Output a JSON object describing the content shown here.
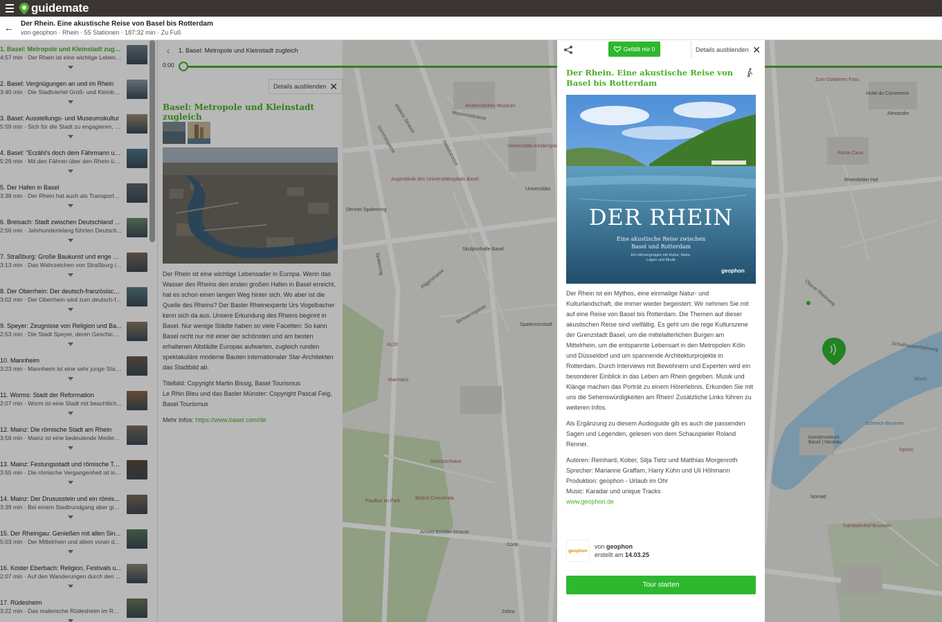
{
  "app": {
    "logo_text": "guidemate"
  },
  "tour": {
    "title": "Der Rhein. Eine akustische Reise von Basel bis Rotterdam",
    "meta": "von geophon · Rhein · 55 Stationen · 187:32 min · Zu Fuß"
  },
  "stations": [
    {
      "title": "1. Basel: Metropole und Kleinstadt zugleich",
      "sub": "4:57 min · Der Rhein ist eine wichtige Lebens...",
      "thumb_color": "#6f7c86",
      "active": true
    },
    {
      "title": "2. Basel: Vergnügungen an und im Rhein",
      "sub": "3:40 min · Die Stadtviertel Groß- und Kleinba...",
      "thumb_color": "#8a9aa8"
    },
    {
      "title": "3. Basel: Ausstellungs- und Museumskultur",
      "sub": "5:59 min · Sich für die Stadt zu engagieren, is...",
      "thumb_color": "#9c8a72"
    },
    {
      "title": "4. Basel: \"Erzähl's doch dem Fährmann un...",
      "sub": "5:29 min · Mit den Fähren über den Rhein üb...",
      "thumb_color": "#4d7a8c"
    },
    {
      "title": "5. Der Hafen in Basel",
      "sub": "3:38 min · Der Rhein hat auch als Transportw...",
      "thumb_color": "#5c6670"
    },
    {
      "title": "6. Breisach: Stadt zwischen Deutschland u...",
      "sub": "2:56 min · Jahrhundertelang führten Deutsch...",
      "thumb_color": "#6b8a70"
    },
    {
      "title": "7. Straßburg: Große Baukunst und enge G...",
      "sub": "3:13 min · Das Wahrzeichen von Straßburg is...",
      "thumb_color": "#7a6a5a"
    },
    {
      "title": "8. Der Oberrhein: Der deutsch-französisch...",
      "sub": "3:02 min · Der Oberrhein wird zum deutsch-f...",
      "thumb_color": "#5a7a86"
    },
    {
      "title": "9. Speyer: Zeugnisse von Religion und Ba...",
      "sub": "2:53 min · Die Stadt Speyer, deren Geschicht...",
      "thumb_color": "#8a7a66"
    },
    {
      "title": "10. Mannheim",
      "sub": "3:23 min · Mannheim ist eine sehr junge Stad...",
      "thumb_color": "#6c5a4c"
    },
    {
      "title": "11. Worms: Stadt der Reformation",
      "sub": "2:07 min · Worm ist eine Stadt mit beachtlich...",
      "thumb_color": "#8c6a48"
    },
    {
      "title": "12. Mainz: Die römische Stadt am Rhein",
      "sub": "3:56 min · Mainz ist eine bedeutende Medien...",
      "thumb_color": "#7a7060"
    },
    {
      "title": "13. Mainz: Festungsstadt und römische Te...",
      "sub": "3:55 min · Die römische Vergangenheit ist in ...",
      "thumb_color": "#5c4a38"
    },
    {
      "title": "14. Mainz: Der Drususstein und ein römis...",
      "sub": "3:39 min · Bei einem Stadtrundgang aber gib...",
      "thumb_color": "#7c6a56"
    },
    {
      "title": "15. Der Rheingau: Genießen mit allen Sin...",
      "sub": "5:03 min · Der Mittelrhein und allem voran d...",
      "thumb_color": "#5a7a5a"
    },
    {
      "title": "16. Koster Eberbach: Religion, Festivals u...",
      "sub": "2:07 min · Auf den Wanderungen durch den ...",
      "thumb_color": "#8a8a7a"
    },
    {
      "title": "17. Rüdesheim",
      "sub": "3:22 min · Das malerische Rüdesheim im Rhe...",
      "thumb_color": "#6a7a5a"
    }
  ],
  "player": {
    "station_title": "1. Basel: Metropole und Kleinstadt zugleich",
    "time": "0:00",
    "progress": 0,
    "hide_details_label": "Details ausblenden"
  },
  "station_detail": {
    "heading": "Basel: Metropole und Kleinstadt zugleich",
    "paragraphs": [
      "Der Rhein ist eine wichtige Lebensader in Europa. Wenn das Wasser des Rheins den ersten großen Hafen in Basel erreicht, hat es schon einen langen Weg hinter sich. Wo aber ist die Quelle des Rheins? Der Basler Rheinexperte Urs Vogelbacher kenn sich da aus. Unsere Erkundung des Rheins beginnt in Basel. Nur wenige Städte haben so viele Facetten: So kann Basel nicht nur mit einer der schönsten und am besten erhaltenen Altstädte Europas aufwarten, zugleich runden spektakuläre moderne Bauten internationaler Star-Architekten das Stadtbild ab.",
      "Titelbild: Copyright Martin Bissig, Basel Tourismus\nLe Rhin Bleu und das Basler Münster: Copyright Pascal Feig, Basel Tourismus"
    ],
    "more_info_label": "Mehr Infos: ",
    "more_info_link": "https://www.basel.com/de"
  },
  "tour_detail": {
    "like_label": "Gefällt mir 0",
    "hide_details_label": "Details ausblenden",
    "title": "Der Rhein. Eine akustische Reise von Basel bis Rotterdam",
    "cover": {
      "title": "DER RHEIN",
      "subtitle_1": "Eine akustische Reise zwischen",
      "subtitle_2": "Basel und Rotterdam",
      "small_1": "Ein Hörvergnügen mit Kultur, Natur,",
      "small_2": "Lagen und Musik",
      "brand": "geophon"
    },
    "description": [
      "Der Rhein ist ein Mythos, eine einmalige Natur- und Kulturlandschaft, die immer wieder begeistert. Wir nehmen Sie mit auf eine Reise von Basel bis Rotterdam. Die Themen auf dieser akustischen Reise sind vielfältig. Es geht um die rege Kulturszene der Grenzstadt Basel, um die mittelalterlichen Burgen am Mittelrhein, um die entspannte Lebensart in den Metropolen Köln und Düsseldorf und um spannende Architekturprojekte in Rotterdam. Durch Interviews mit Bewohnern und Experten wird ein besonderer Einblick in das Leben am Rhein gegeben. Musik und Klänge machen das Porträt zu einem Hörerlebnis. Erkunden Sie mit uns die Sehenswürdigkeiten am Rhein! Zusätzliche Links führen zu weiteren Infos.",
      "Als Ergänzung zu diesem Audioguide gib es auch die passenden Sagen und Legenden, gelesen von dem Schauspieler Roland Renner."
    ],
    "credits": {
      "authors": "Autoren: Reinhard, Kober, Silja Tietz und Matthias Morgenroth",
      "speakers": "Sprecher: Marianne Graffam, Harry Kühn und Uli Höhmann",
      "production": "Produktion: geophon - Urlaub im Ohr",
      "music": "Music: Karadar und unique Tracks",
      "link": "www.geophon.de"
    },
    "author": {
      "logo_text": "geophon",
      "by_prefix": "von ",
      "name": "geophon",
      "created_prefix": "erstellt am ",
      "created_date": "14.03.25"
    },
    "start_label": "Tour starten"
  },
  "map": {
    "labels": [
      "Anatomisches Museum",
      "Universitäts-Kinderspital Beider Basel",
      "Augenklinik des Universitätsspitals Basel",
      "Denner Spalenring",
      "Skulpturhalle Basel",
      "Universitäts",
      "Spalenvorstadt",
      "ALDI",
      "Marmaris",
      "Schützenhaus",
      "Pavillon im Park",
      "Bistrot Crescenda",
      "Arnold Böcklin-Strasse",
      "Zum Goldenen Fass",
      "Hotel du Commerce",
      "Alexander",
      "Punta Cana",
      "Rheinfelder Hof",
      "Kunstmuseum Basel | Neubau",
      "Schneck-Brunnen",
      "Rhein",
      "Trambahnhof-Brunnen",
      "Nomad",
      "Spoon",
      "Coop",
      "Zebra",
      "Hotel Basel",
      "Mittlere Strasse",
      "Sommergasse",
      "Hebelstrasse",
      "Missionsstrasse",
      "Spalenring",
      "Pilgerstrasse",
      "Birmannsgasse",
      "Schafhauserrheinweg",
      "Oberer Rheinweg"
    ]
  }
}
